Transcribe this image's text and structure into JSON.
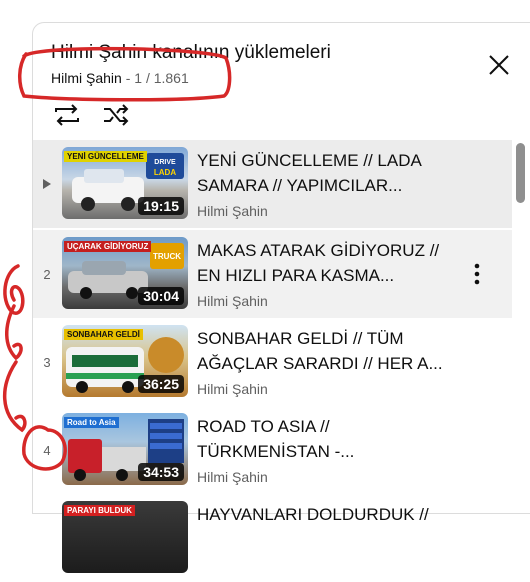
{
  "header": {
    "title": "Hilmi Şahin kanalının yüklemeleri",
    "channel": "Hilmi Şahin",
    "separator": "-",
    "position": "1 / 1.861"
  },
  "controls": {
    "loop_icon": "loop-icon",
    "shuffle_icon": "shuffle-icon",
    "close_icon": "close-icon"
  },
  "videos": [
    {
      "index": "",
      "title": "YENİ GÜNCELLEME // LADA SAMARA // YAPIMCILAR...",
      "channel": "Hilmi Şahin",
      "duration": "19:15",
      "thumb_caption": "YENİ GÜNCELLEME"
    },
    {
      "index": "2",
      "title": "MAKAS ATARAK GİDİYORUZ // EN HIZLI PARA KASMA...",
      "channel": "Hilmi Şahin",
      "duration": "30:04",
      "thumb_caption": "UÇARAK GİDİYORUZ"
    },
    {
      "index": "3",
      "title": "SONBAHAR GELDİ // TÜM AĞAÇLAR SARARDI // HER A...",
      "channel": "Hilmi Şahin",
      "duration": "36:25",
      "thumb_caption": "SONBAHAR GELDİ"
    },
    {
      "index": "4",
      "title": "ROAD TO ASIA // TÜRKMENİSTAN -...",
      "channel": "Hilmi Şahin",
      "duration": "34:53",
      "thumb_caption": "Road to Asia"
    },
    {
      "index": "",
      "title": "HAYVANLARI DOLDURDUK //",
      "channel": "",
      "duration": "",
      "thumb_caption": "PARAYI BULDUK"
    }
  ],
  "colors": {
    "annotation": "#d62828",
    "active_row": "#ececec"
  }
}
